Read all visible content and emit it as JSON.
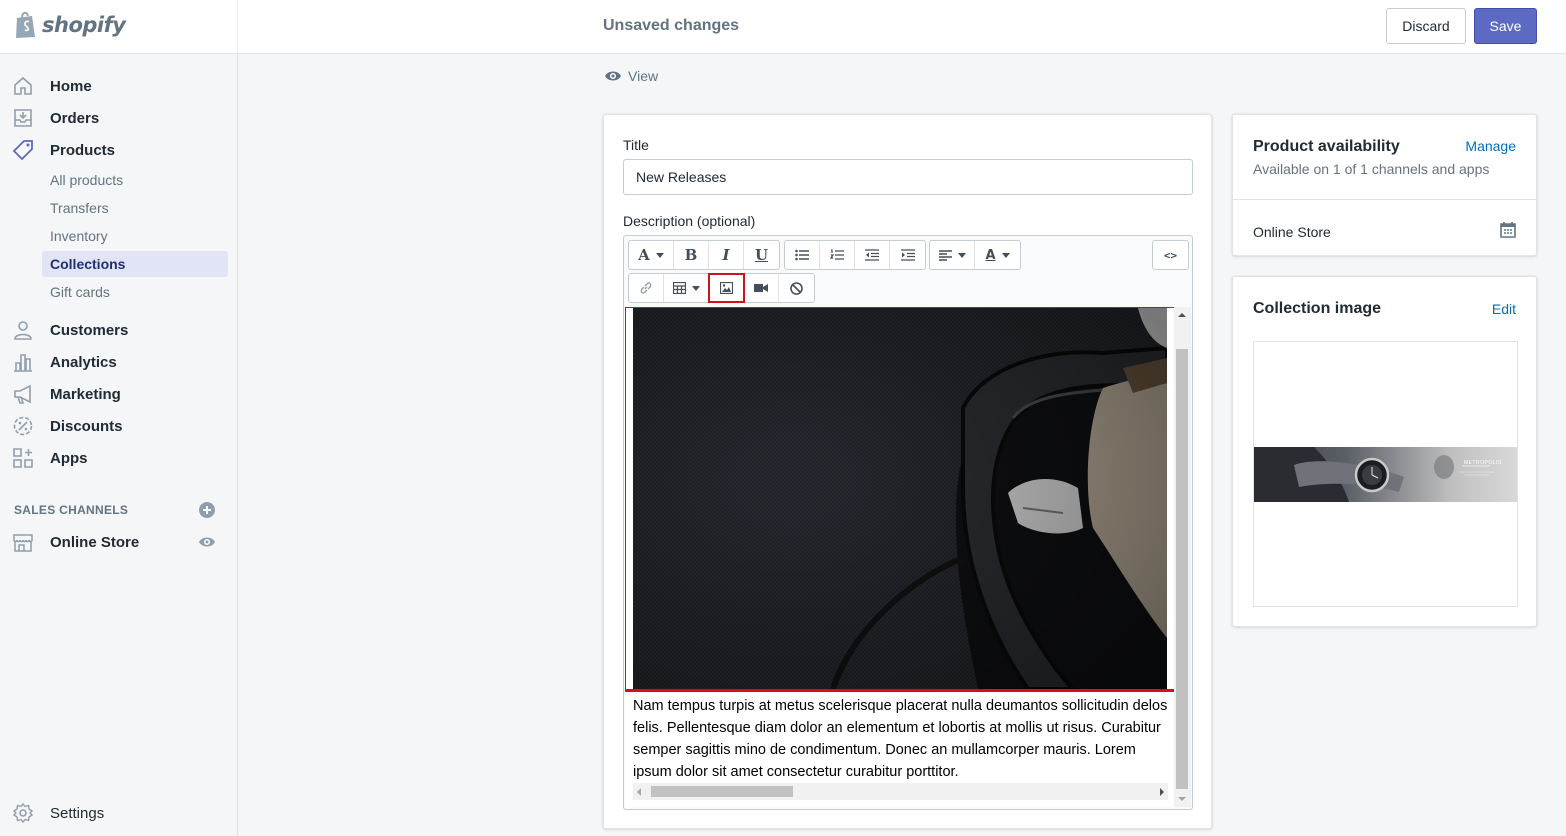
{
  "brand": {
    "name": "shopify"
  },
  "header": {
    "status": "Unsaved changes",
    "discard_label": "Discard",
    "save_label": "Save"
  },
  "sidebar": {
    "items": [
      {
        "label": "Home",
        "icon": "home-icon"
      },
      {
        "label": "Orders",
        "icon": "orders-icon"
      },
      {
        "label": "Products",
        "icon": "tag-icon"
      }
    ],
    "product_subitems": [
      "All products",
      "Transfers",
      "Inventory",
      "Collections",
      "Gift cards"
    ],
    "active_subitem": "Collections",
    "more_items": [
      {
        "label": "Customers",
        "icon": "person-icon"
      },
      {
        "label": "Analytics",
        "icon": "bar-chart-icon"
      },
      {
        "label": "Marketing",
        "icon": "megaphone-icon"
      },
      {
        "label": "Discounts",
        "icon": "discount-icon"
      },
      {
        "label": "Apps",
        "icon": "apps-icon"
      }
    ],
    "sales_channels_heading": "SALES CHANNELS",
    "online_store": "Online Store",
    "settings": "Settings"
  },
  "main": {
    "view_label": "View",
    "title_label": "Title",
    "title_value": "New Releases",
    "description_label": "Description (optional)",
    "toolbar": {
      "html_label": "<>"
    },
    "description_text": "Nam tempus turpis at metus scelerisque placerat nulla deumantos sollicitudin delos felis. Pellentesque diam dolor an elementum et lobortis at mollis ut risus. Curabitur semper sagittis mino de condimentum. Donec an mullamcorper mauris. Lorem ipsum dolor sit amet consectetur curabitur porttitor."
  },
  "availability": {
    "title": "Product availability",
    "manage_label": "Manage",
    "subtitle": "Available on 1 of 1 channels and apps",
    "channel": "Online Store"
  },
  "collection_image": {
    "title": "Collection image",
    "edit_label": "Edit",
    "banner_text": "METROPOLIS"
  },
  "colors": {
    "accent": "#5c6ac4",
    "link": "#006fbb",
    "highlight": "#d0101b"
  }
}
